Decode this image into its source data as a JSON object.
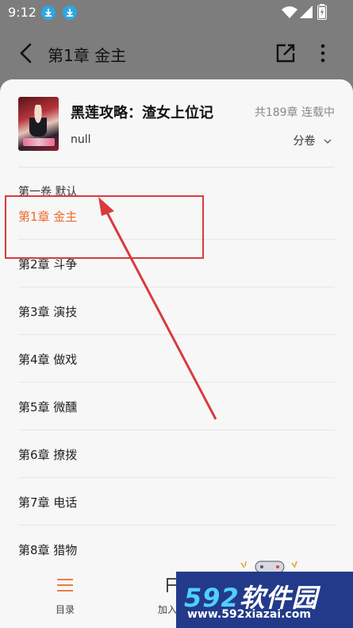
{
  "status_bar": {
    "time": "9:12",
    "icons": [
      "download-icon",
      "download-icon",
      "wifi-icon",
      "signal-icon",
      "battery-icon"
    ]
  },
  "nav": {
    "title": "第1章 金主",
    "icons": [
      "back-icon",
      "share-icon",
      "more-icon"
    ]
  },
  "book": {
    "title": "黑莲攻略：渣女上位记",
    "meta": "共189章 连载中",
    "author": "null",
    "volume_toggle": "分卷"
  },
  "volume_label": "第一卷 默认",
  "chapters": [
    {
      "label": "第1章 金主",
      "current": true
    },
    {
      "label": "第2章 斗争",
      "current": false
    },
    {
      "label": "第3章 演技",
      "current": false
    },
    {
      "label": "第4章 做戏",
      "current": false
    },
    {
      "label": "第5章 微醺",
      "current": false
    },
    {
      "label": "第6章 撩拨",
      "current": false
    },
    {
      "label": "第7章 电话",
      "current": false
    },
    {
      "label": "第8章 猎物",
      "current": false
    }
  ],
  "bottom_bar": {
    "toc_label": "目录",
    "add_label": "加入"
  },
  "watermark": {
    "brand_num": "592",
    "brand_text": "软件园",
    "url": "www.592xiazai.com"
  },
  "colors": {
    "accent": "#ef6a2a",
    "annotation": "#d93a3f",
    "overlay": "#7d7d7d"
  }
}
